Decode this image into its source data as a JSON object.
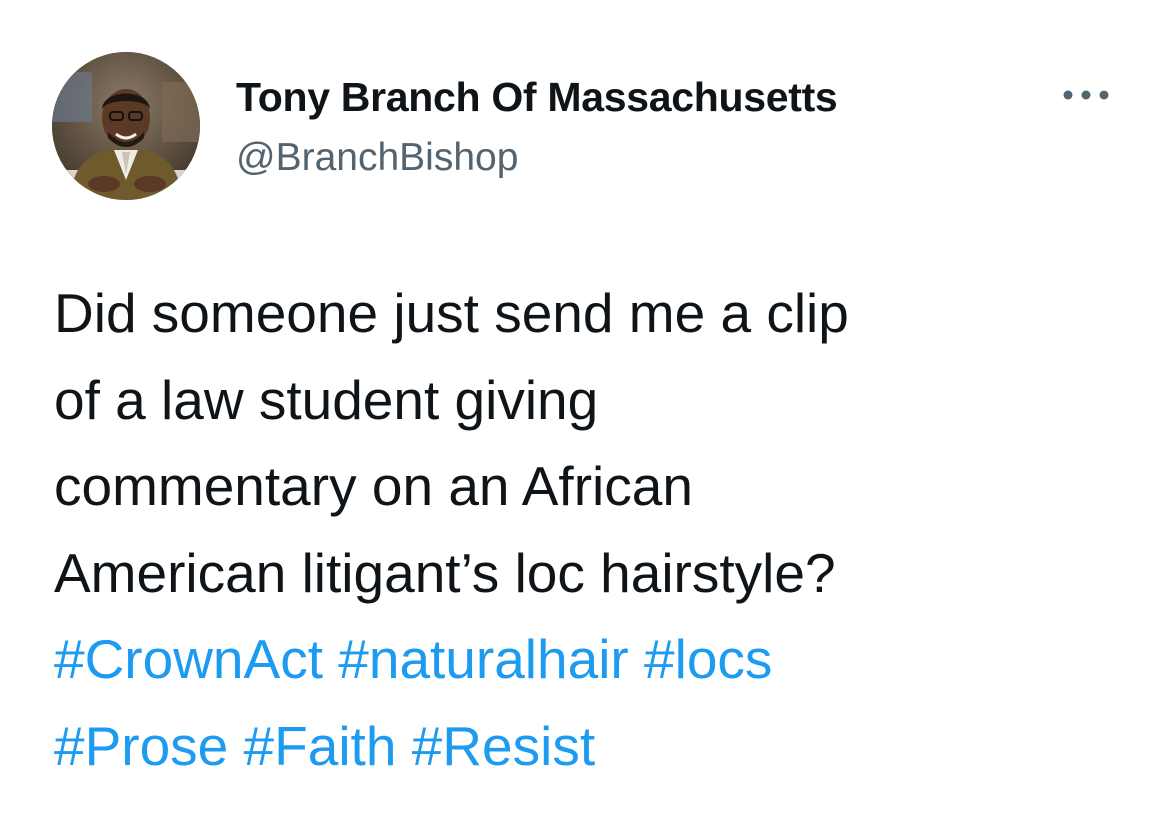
{
  "author": {
    "display_name": "Tony Branch Of Massachusetts",
    "handle": "@BranchBishop",
    "avatar_icon": "profile-photo"
  },
  "more_icon": "more-horizontal-icon",
  "tweet": {
    "lines": [
      "Did someone just send me a clip",
      "of a law student giving",
      "commentary on an African",
      "American litigant’s loc hairstyle?"
    ],
    "hashtag_lines": [
      [
        "#CrownAct",
        "#naturalhair",
        "#locs"
      ],
      [
        "#Prose",
        "#Faith",
        "#Resist"
      ]
    ]
  },
  "colors": {
    "text": "#0f1419",
    "secondary": "#536471",
    "link": "#1d9bf0",
    "background": "#ffffff"
  }
}
